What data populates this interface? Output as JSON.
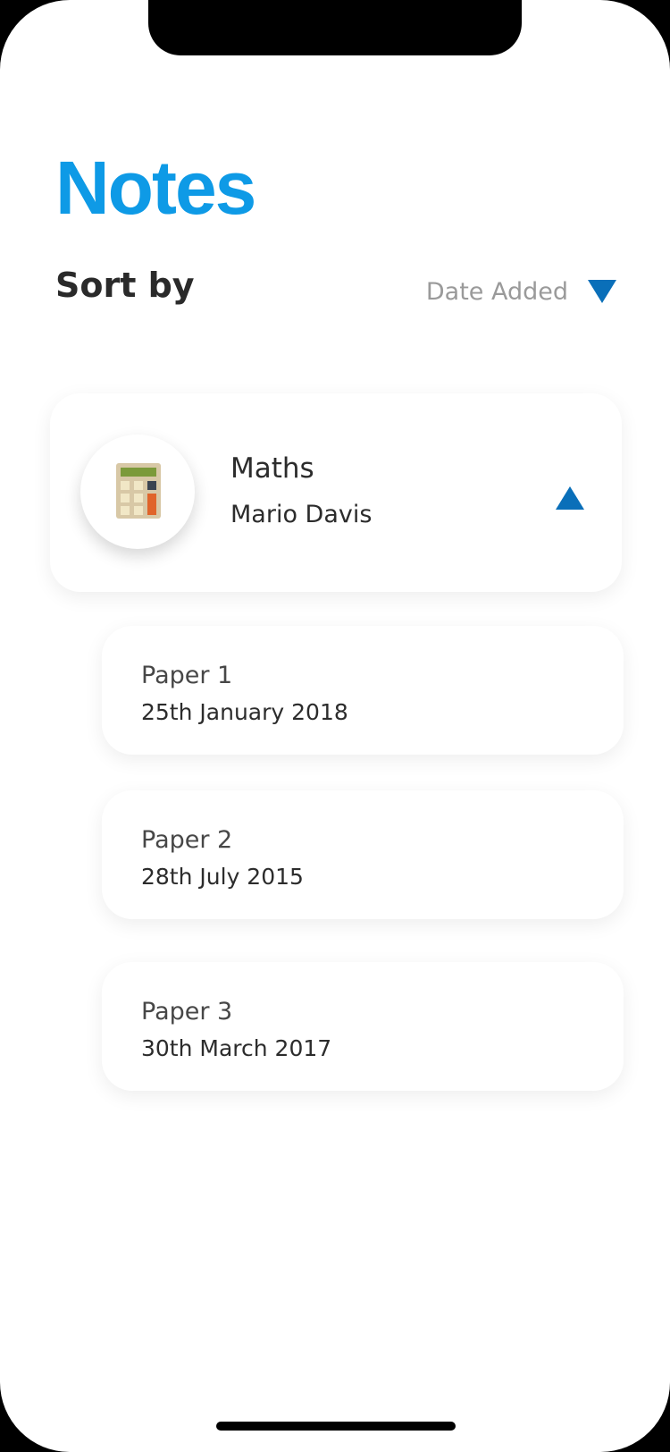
{
  "header": {
    "title": "Notes"
  },
  "sort": {
    "label": "Sort by",
    "value": "Date Added"
  },
  "subject": {
    "name": "Maths",
    "teacher": "Mario Davis",
    "icon": "calculator-icon",
    "expanded": true
  },
  "papers": [
    {
      "title": "Paper 1",
      "date": "25th January 2018"
    },
    {
      "title": "Paper 2",
      "date": "28th July 2015"
    },
    {
      "title": "Paper 3",
      "date": "30th March 2017"
    }
  ],
  "colors": {
    "title": "#0e9ae6",
    "accent": "#0a6fb9",
    "text": "#2c2c2c",
    "muted": "#9a9a9a"
  }
}
